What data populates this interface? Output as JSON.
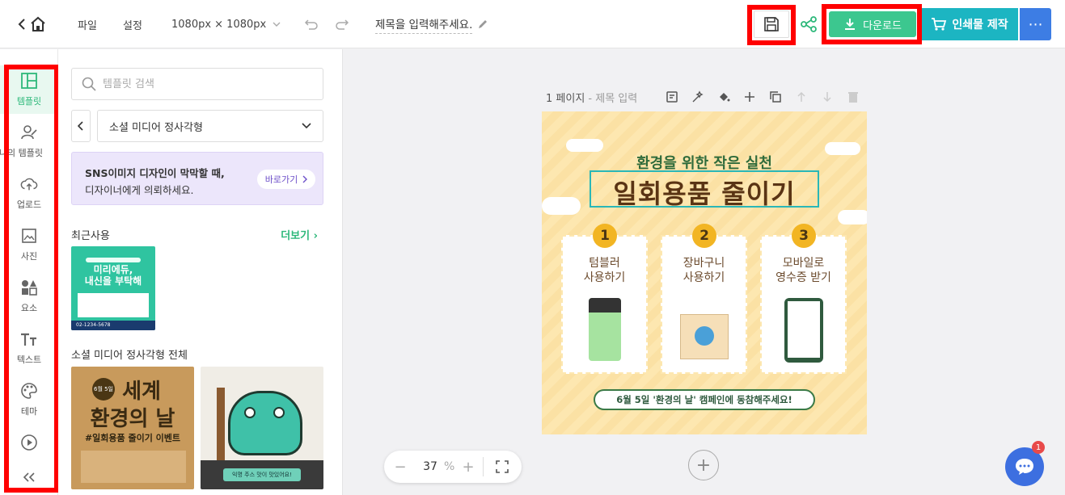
{
  "topbar": {
    "menu_file": "파일",
    "menu_settings": "설정",
    "canvas_size": "1080px × 1080px",
    "doc_title_placeholder": "제목을 입력해주세요.",
    "download_label": "다운로드",
    "print_label": "인쇄물 제작",
    "more_label": "⋯"
  },
  "sidebar": {
    "items": [
      {
        "label": "템플릿",
        "icon": "layout-icon"
      },
      {
        "label": "나의 템플릿",
        "icon": "user-edit-icon"
      },
      {
        "label": "업로드",
        "icon": "cloud-upload-icon"
      },
      {
        "label": "사진",
        "icon": "image-icon"
      },
      {
        "label": "요소",
        "icon": "shapes-icon"
      },
      {
        "label": "텍스트",
        "icon": "text-icon"
      },
      {
        "label": "테마",
        "icon": "palette-icon"
      },
      {
        "label": "",
        "icon": "play-icon"
      },
      {
        "label": "",
        "icon": "collapse-icon"
      }
    ]
  },
  "panel": {
    "search_placeholder": "템플릿 검색",
    "category": "소셜 미디어 정사각형",
    "promo_line1": "SNS이미지 디자인이 막막할 때,",
    "promo_line2": "디자이너에게 의뢰하세요.",
    "promo_button": "바로가기",
    "recent_title": "최근사용",
    "more_label": "더보기",
    "all_title": "소셜 미디어 정사각형 전체",
    "recent_thumb": {
      "line1": "미리에듀,",
      "line2": "내신을 부탁해",
      "phone": "02-1234-5678"
    },
    "thumb1": {
      "date": "6월 5일",
      "title1": "세계",
      "title2": "환경의 날",
      "sub": "#일회용품 줄이기 이벤트"
    },
    "thumb2": {
      "caption": "익명 주스 맛이 맛있어요!"
    }
  },
  "canvas": {
    "page_label": "1 페이지",
    "page_sub": " - 제목 입력",
    "zoom_value": "37",
    "zoom_unit": "%"
  },
  "design": {
    "subtitle": "환경을 위한 작은 실천",
    "title": "일회용품 줄이기",
    "cards": [
      {
        "num": "1",
        "line1": "텀블러",
        "line2": "사용하기"
      },
      {
        "num": "2",
        "line1": "장바구니",
        "line2": "사용하기"
      },
      {
        "num": "3",
        "line1": "모바일로",
        "line2": "영수증 받기"
      }
    ],
    "footer": "6월 5일 '환경의 날' 캠페인에 동참해주세요!"
  },
  "chat": {
    "badge": "1"
  },
  "colors": {
    "accent_green": "#3cc78f",
    "print_teal": "#1cb5c2",
    "more_blue": "#3d7de4",
    "highlight_red": "#ff0000",
    "design_bg": "#fde7b0"
  }
}
